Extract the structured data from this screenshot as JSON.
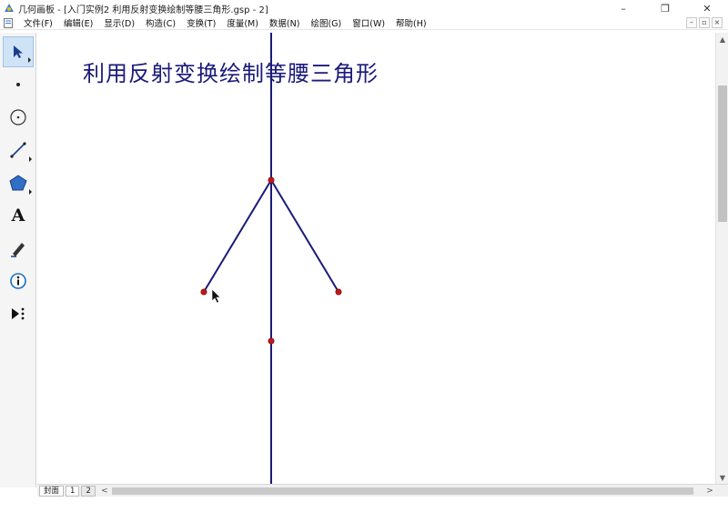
{
  "window": {
    "title": "几何画板 - [入门实例2 利用反射变换绘制等腰三角形.gsp - 2]",
    "controls": {
      "minimize": "–",
      "restore": "❐",
      "close": "✕"
    }
  },
  "menu": {
    "items": [
      "文件(F)",
      "编辑(E)",
      "显示(D)",
      "构造(C)",
      "变换(T)",
      "度量(M)",
      "数据(N)",
      "绘图(G)",
      "窗口(W)",
      "帮助(H)"
    ],
    "mdi": {
      "minimize": "–",
      "restore": "▫",
      "close": "×"
    }
  },
  "toolbox": {
    "tools": [
      {
        "name": "arrow-select-tool",
        "icon": "arrow-icon",
        "selected": true
      },
      {
        "name": "point-tool",
        "icon": "point-icon"
      },
      {
        "name": "compass-tool",
        "icon": "circle-icon"
      },
      {
        "name": "straightedge-tool",
        "icon": "segment-icon"
      },
      {
        "name": "polygon-tool",
        "icon": "polygon-icon"
      },
      {
        "name": "text-tool",
        "icon": "text-a-icon",
        "glyph": "A"
      },
      {
        "name": "marker-tool",
        "icon": "pen-icon"
      },
      {
        "name": "information-tool",
        "icon": "info-icon"
      },
      {
        "name": "custom-tool",
        "icon": "play-dots-icon"
      }
    ]
  },
  "canvas": {
    "heading": "利用反射变换绘制等腰三角形",
    "line_color": "#1a1a7a",
    "point_color": "#c01818"
  },
  "pages": {
    "tabs": [
      "封面",
      "1",
      "2"
    ],
    "active": "2"
  },
  "scroll": {
    "up": "▲",
    "down": "▼",
    "left": "<",
    "right": ">"
  }
}
